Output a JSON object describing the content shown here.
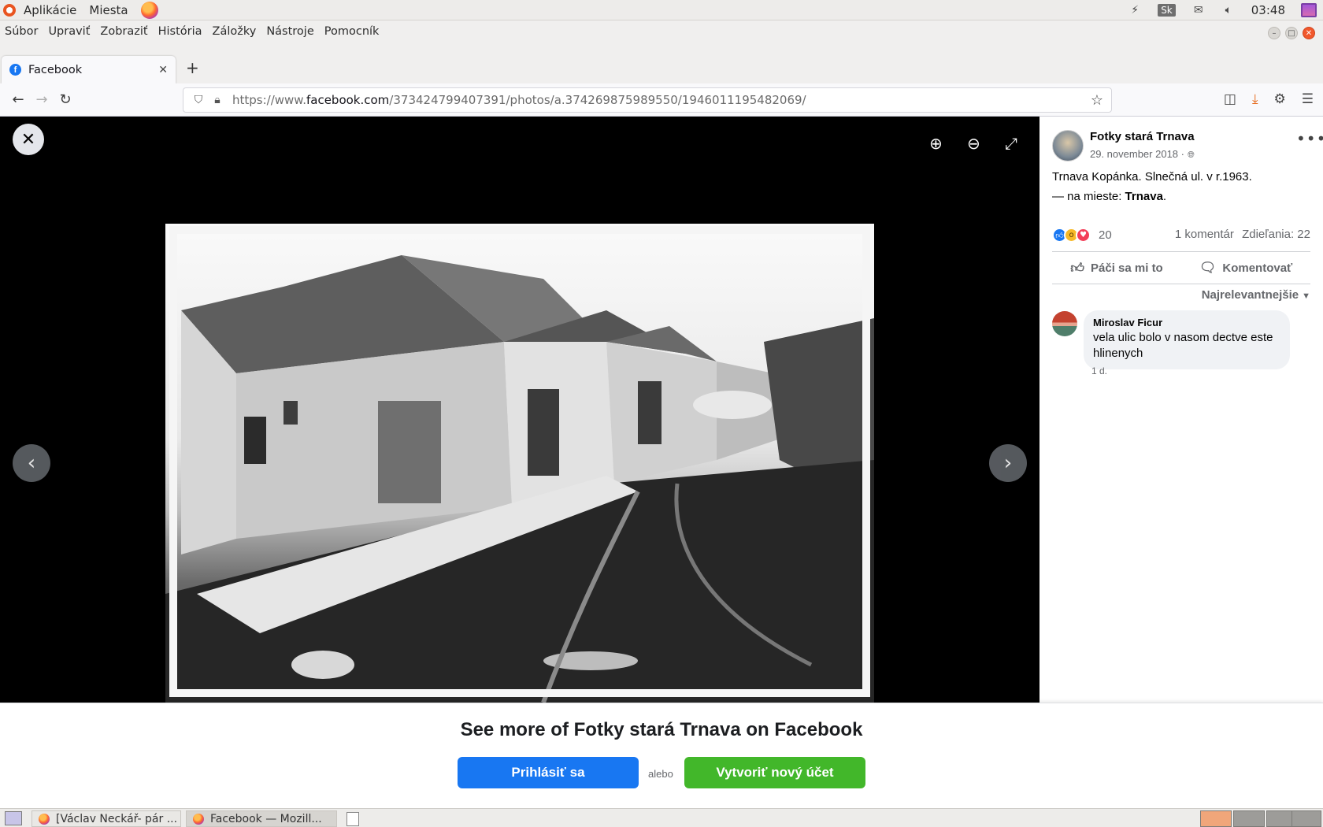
{
  "system_panel": {
    "apps_label": "Aplikácie",
    "places_label": "Miesta",
    "keyboard_layout": "Sk",
    "clock": "03:48"
  },
  "menubar": {
    "items": [
      "Súbor",
      "Upraviť",
      "Zobraziť",
      "História",
      "Záložky",
      "Nástroje",
      "Pomocník"
    ]
  },
  "browser": {
    "tab_title": "Facebook",
    "url_prefix": "https://www.",
    "url_domain": "facebook.com",
    "url_path": "/373424799407391/photos/a.374269875989550/1946011195482069/"
  },
  "post": {
    "page_name": "Fotky stará Trnava",
    "date": "29. november 2018 ·",
    "caption_line1": "Trnava Kopánka. Slnečná ul. v r.1963.",
    "location_prefix": "— na mieste: ",
    "location_name": "Trnava",
    "location_suffix": ".",
    "reaction_count": "20",
    "comments_count": "1 komentár",
    "shares": "Zdieľania: 22",
    "like_label": "Páči sa mi to",
    "comment_label": "Komentovať",
    "sort_label": "Najrelevantnejšie"
  },
  "comment": {
    "author": "Miroslav Ficur",
    "text": "vela ulic bolo v nasom dectve este hlinenych",
    "age": "1 d."
  },
  "login_banner": {
    "title": "See more of Fotky stará Trnava on Facebook",
    "login_label": "Prihlásiť sa",
    "or_label": "alebo",
    "signup_label": "Vytvoriť nový účet"
  },
  "taskbar": {
    "item1": "[Václav Neckář- pár ...",
    "item2": "Facebook — Mozill..."
  },
  "colors": {
    "facebook_blue": "#1877f2",
    "signup_green": "#42b72a",
    "viewer_bg": "#000000"
  }
}
